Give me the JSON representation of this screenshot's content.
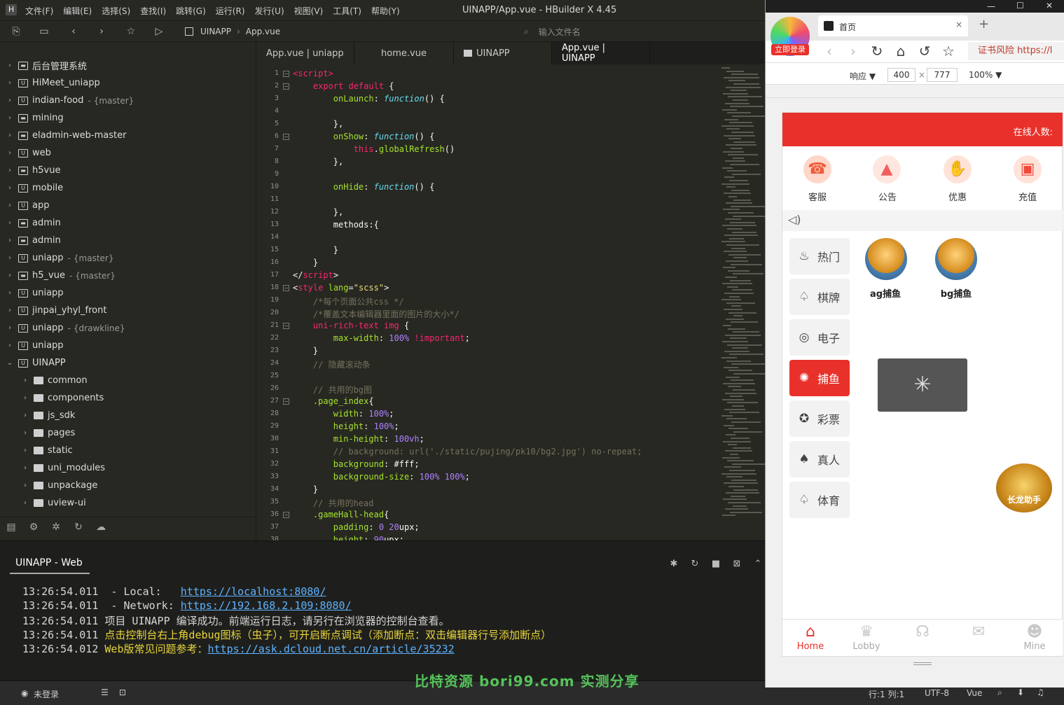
{
  "window": {
    "title": "UINAPP/App.vue - HBuilder X 4.45",
    "logo": "H"
  },
  "menu": [
    "文件(F)",
    "编辑(E)",
    "选择(S)",
    "查找(I)",
    "跳转(G)",
    "运行(R)",
    "发行(U)",
    "视图(V)",
    "工具(T)",
    "帮助(Y)"
  ],
  "breadcrumb": {
    "project": "UINAPP",
    "file": "App.vue"
  },
  "file_search": {
    "placeholder": "输入文件名"
  },
  "tree": [
    {
      "name": "后台管理系统",
      "type": "folder",
      "branch": ""
    },
    {
      "name": "HiMeet_uniapp",
      "type": "uni",
      "branch": ""
    },
    {
      "name": "indian-food",
      "type": "uni",
      "branch": "{master}"
    },
    {
      "name": "mining",
      "type": "folder",
      "branch": ""
    },
    {
      "name": "eladmin-web-master",
      "type": "folder",
      "branch": ""
    },
    {
      "name": "web",
      "type": "uni",
      "branch": ""
    },
    {
      "name": "h5vue",
      "type": "folder",
      "branch": ""
    },
    {
      "name": "mobile",
      "type": "uni",
      "branch": ""
    },
    {
      "name": "app",
      "type": "uni",
      "branch": ""
    },
    {
      "name": "admin",
      "type": "folder",
      "branch": ""
    },
    {
      "name": "admin",
      "type": "folder",
      "branch": ""
    },
    {
      "name": "uniapp",
      "type": "uni",
      "branch": "{master}"
    },
    {
      "name": "h5_vue",
      "type": "folder",
      "branch": "{master}"
    },
    {
      "name": "uniapp",
      "type": "uni",
      "branch": ""
    },
    {
      "name": "jinpai_yhyl_front",
      "type": "uni",
      "branch": ""
    },
    {
      "name": "uniapp",
      "type": "uni",
      "branch": "{drawkline}"
    },
    {
      "name": "uniapp",
      "type": "uni",
      "branch": ""
    },
    {
      "name": "UINAPP",
      "type": "uni",
      "branch": "",
      "open": true
    },
    {
      "name": "common",
      "type": "dir",
      "branch": ""
    },
    {
      "name": "components",
      "type": "dir",
      "branch": ""
    },
    {
      "name": "js_sdk",
      "type": "dir",
      "branch": ""
    },
    {
      "name": "pages",
      "type": "dir",
      "branch": ""
    },
    {
      "name": "static",
      "type": "dir",
      "branch": ""
    },
    {
      "name": "uni_modules",
      "type": "dir",
      "branch": ""
    },
    {
      "name": "unpackage",
      "type": "dir",
      "branch": ""
    },
    {
      "name": "uview-ui",
      "type": "dir",
      "branch": ""
    }
  ],
  "tabs": [
    "App.vue | uniapp",
    "home.vue",
    "UINAPP",
    "App.vue | UINAPP"
  ],
  "console": {
    "title": "UINAPP - Web",
    "lines": [
      {
        "time": "13:26:54.011",
        "label": "  - Local:   ",
        "link": "https://localhost:8080/"
      },
      {
        "time": "13:26:54.011",
        "label": "  - Network: ",
        "link": "https://192.168.2.109:8080/"
      },
      {
        "time": "13:26:54.011",
        "text": "项目 UINAPP 编译成功。前端运行日志，请另行在浏览器的控制台查看。"
      },
      {
        "time": "13:26:54.011",
        "yellow": "点击控制台右上角debug图标（虫子），可开启断点调试（添加断点：双击编辑器行号添加断点）"
      },
      {
        "time": "13:26:54.012",
        "yellow": "Web版常见问题参考：",
        "link": "https://ask.dcloud.net.cn/article/35232"
      }
    ]
  },
  "status": {
    "login": "未登录",
    "position": "行:1  列:1",
    "encoding": "UTF-8",
    "language": "Vue"
  },
  "watermark": "比特资源 bori99.com 实测分享",
  "browser": {
    "tab_title": "首页",
    "logo_badge": "立即登录",
    "address": "证书风险 https://l",
    "device": {
      "mode": "响应 ▼",
      "width": "400",
      "times": "×",
      "height": "777",
      "zoom": "100% ▼"
    }
  },
  "app": {
    "header": "在线人数:",
    "quick": [
      {
        "label": "客服",
        "icon": "headset-icon"
      },
      {
        "label": "公告",
        "icon": "chart-icon"
      },
      {
        "label": "优惠",
        "icon": "coupon-icon"
      },
      {
        "label": "充值",
        "icon": "wallet-icon"
      }
    ],
    "categories": [
      {
        "label": "热门",
        "icon": "fire-icon"
      },
      {
        "label": "棋牌",
        "icon": "spade-icon"
      },
      {
        "label": "电子",
        "icon": "chip-icon"
      },
      {
        "label": "捕鱼",
        "icon": "fish-icon",
        "active": true
      },
      {
        "label": "彩票",
        "icon": "lottery-icon"
      },
      {
        "label": "真人",
        "icon": "cards-icon"
      },
      {
        "label": "体育",
        "icon": "sport-icon"
      }
    ],
    "games": [
      "ag捕鱼",
      "bg捕鱼"
    ],
    "helper": "长龙助手",
    "bottom_tabs": [
      {
        "label": "Home",
        "active": true
      },
      {
        "label": "Lobby"
      },
      {
        "label": ""
      },
      {
        "label": ""
      },
      {
        "label": "Mine"
      }
    ]
  }
}
